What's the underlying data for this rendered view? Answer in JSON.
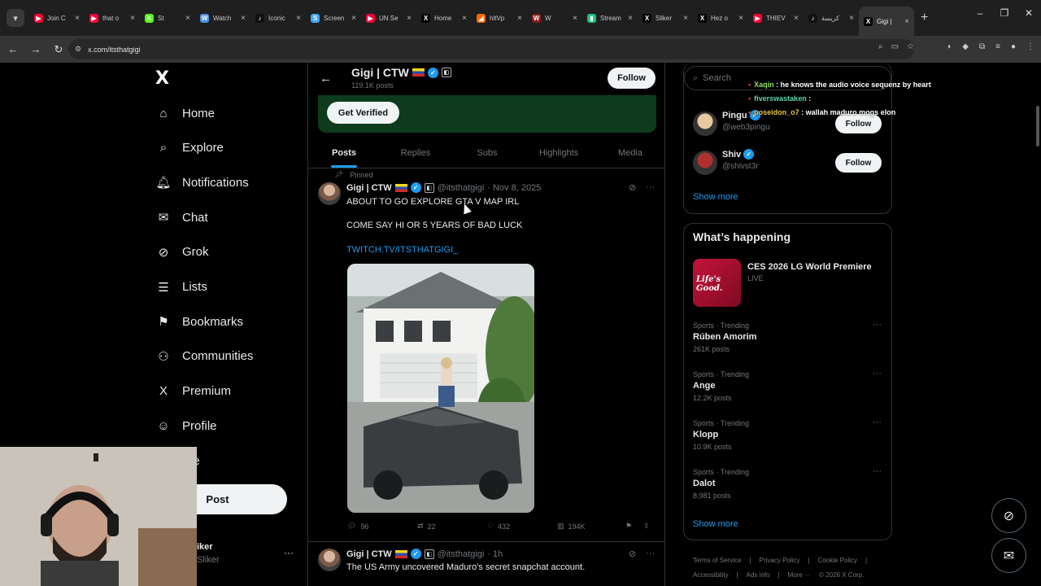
{
  "browser": {
    "tabs": [
      {
        "label": "Join C",
        "color": "#ff0033",
        "glyph": "▶"
      },
      {
        "label": "that o",
        "color": "#ff0033",
        "glyph": "▶"
      },
      {
        "label": "St",
        "color": "#53fc18",
        "glyph": "K"
      },
      {
        "label": "Watch",
        "color": "#4a90e2",
        "glyph": "W"
      },
      {
        "label": "Iconic",
        "color": "#111111",
        "glyph": "♪"
      },
      {
        "label": "Screen",
        "color": "#3ea6ff",
        "glyph": "S"
      },
      {
        "label": "UN Se",
        "color": "#ff0033",
        "glyph": "▶"
      },
      {
        "label": "Home",
        "color": "#000000",
        "glyph": "X"
      },
      {
        "label": "hltVp",
        "color": "#ff6a00",
        "glyph": "◢"
      },
      {
        "label": "W",
        "color": "#8b1a1a",
        "glyph": "W"
      },
      {
        "label": "Stream",
        "color": "#19c37d",
        "glyph": "▮"
      },
      {
        "label": "Sliker",
        "color": "#000000",
        "glyph": "X"
      },
      {
        "label": "Hez o",
        "color": "#000000",
        "glyph": "X"
      },
      {
        "label": "THIEV",
        "color": "#ff0033",
        "glyph": "▶"
      },
      {
        "label": "كريسة",
        "color": "#111111",
        "glyph": "♪"
      },
      {
        "label": "Gigi |",
        "color": "#000000",
        "glyph": "X"
      }
    ],
    "url": "x.com/itsthatgigi"
  },
  "sidebar": {
    "logo": "X",
    "items": [
      {
        "label": "Home",
        "icon": "⌂",
        "name": "home"
      },
      {
        "label": "Explore",
        "icon": "⌕",
        "name": "explore"
      },
      {
        "label": "Notifications",
        "icon": "🔔︎",
        "name": "notifications"
      },
      {
        "label": "Chat",
        "icon": "✉",
        "name": "chat"
      },
      {
        "label": "Grok",
        "icon": "⊘",
        "name": "grok"
      },
      {
        "label": "Lists",
        "icon": "☰",
        "name": "lists"
      },
      {
        "label": "Bookmarks",
        "icon": "⚑",
        "name": "bookmarks"
      },
      {
        "label": "Communities",
        "icon": "⚇",
        "name": "communities"
      },
      {
        "label": "Premium",
        "icon": "X",
        "name": "premium"
      },
      {
        "label": "Profile",
        "icon": "☺",
        "name": "profile"
      },
      {
        "label": "ore",
        "icon": "",
        "name": "more"
      }
    ],
    "post_label": "Post",
    "account_name": "iker",
    "account_handle": "Sliker",
    "account_more": "···"
  },
  "profile": {
    "name": "Gigi | CTW",
    "posts_count": "119.1K posts",
    "follow_label": "Follow",
    "get_verified": "Get Verified",
    "tabs": [
      "Posts",
      "Replies",
      "Subs",
      "Highlights",
      "Media"
    ]
  },
  "tweets": [
    {
      "pinned": "Pinned",
      "name": "Gigi | CTW",
      "handle": "@itsthatgigi",
      "date": "· Nov 8, 2025",
      "line1": "ABOUT TO GO EXPLORE GTA V MAP IRL",
      "line2": "COME SAY HI OR 5 YEARS OF BAD LUCK",
      "link": "TWITCH.TV/ITSTHATGIGI_",
      "replies": "96",
      "reposts": "22",
      "likes": "432",
      "views": "194K"
    },
    {
      "name": "Gigi | CTW",
      "handle": "@itsthatgigi",
      "date": "· 1h",
      "line1": "The US Army uncovered Maduro's secret snapchat account."
    }
  ],
  "right": {
    "search_placeholder": "Search",
    "who_to_follow": [
      {
        "name": "Pingu",
        "handle": "@web3pingu",
        "follow": "Follow"
      },
      {
        "name": "Shiv",
        "handle": "@shivst3r",
        "follow": "Follow"
      }
    ],
    "show_more": "Show more",
    "happening_title": "What’s happening",
    "ces": {
      "title": "CES 2026 LG World Premiere",
      "status": "LIVE",
      "img_text": "Life's Good."
    },
    "trends": [
      {
        "cat": "Sports · Trending",
        "name": "Rúben Amorim",
        "count": "261K posts"
      },
      {
        "cat": "Sports · Trending",
        "name": "Ange",
        "count": "12.2K posts"
      },
      {
        "cat": "Sports · Trending",
        "name": "Klopp",
        "count": "10.9K posts"
      },
      {
        "cat": "Sports · Trending",
        "name": "Dalot",
        "count": "8,981 posts"
      }
    ],
    "show_more_2": "Show more",
    "footer": [
      "Terms of Service",
      "|",
      "Privacy Policy",
      "|",
      "Cookie Policy",
      "|",
      "Accessibility",
      "|",
      "Ads info",
      "|",
      "More ···",
      "© 2026 X Corp."
    ]
  },
  "chat_overlay": [
    {
      "user": "Xaqin",
      "msg": " : he knows the audio voice sequenz by heart"
    },
    {
      "user": "fiverswastaken",
      "msg": " :"
    },
    {
      "user": "poseidon_o7",
      "msg": " : wallah maduro mogs elon"
    }
  ]
}
